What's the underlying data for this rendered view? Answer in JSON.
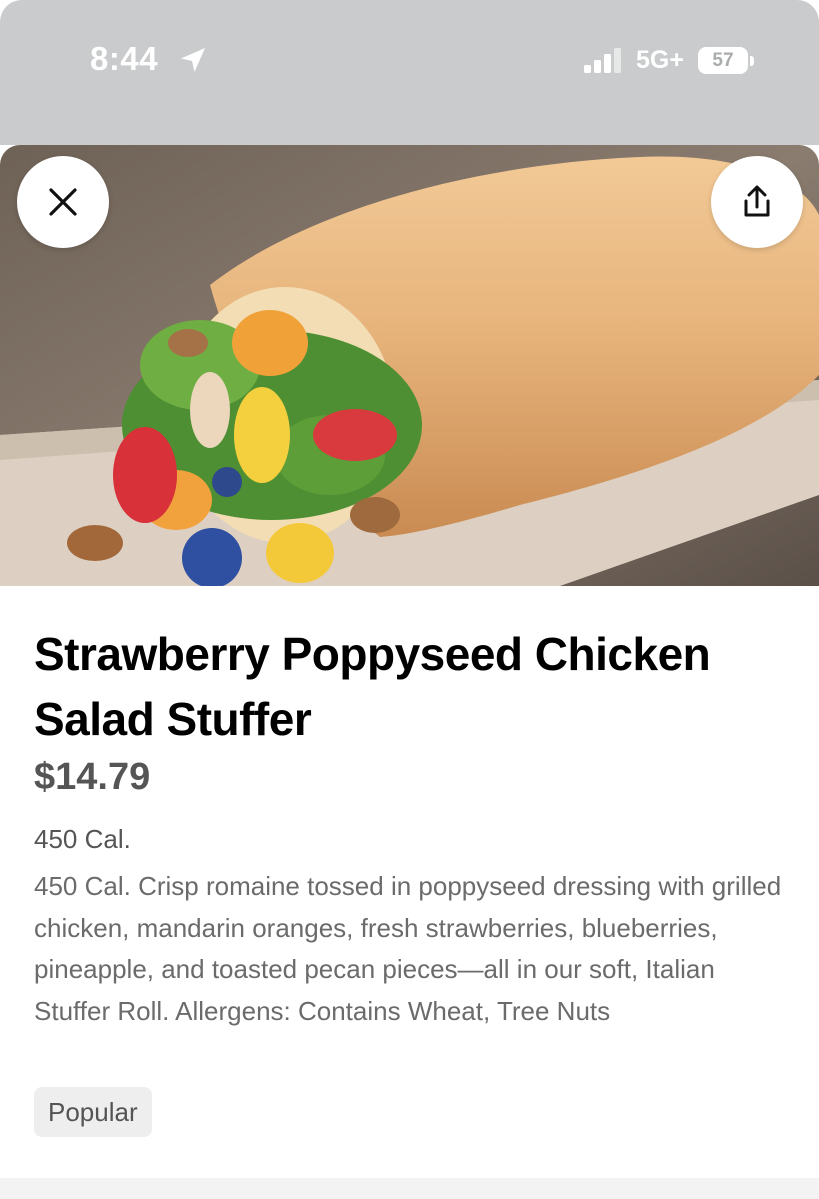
{
  "status_bar": {
    "time": "8:44",
    "network": "5G+",
    "battery": "57",
    "icons": [
      "location-arrow-icon",
      "signal-bars-icon"
    ]
  },
  "hero": {
    "image": "sandwich-photo",
    "actions": {
      "close_icon": "close-icon",
      "share_icon": "share-icon"
    }
  },
  "item": {
    "title": "Strawberry Poppyseed Chicken Salad Stuffer",
    "price": "$14.79",
    "calories": "450 Cal.",
    "description": "450 Cal. Crisp romaine tossed in poppyseed dressing with grilled chicken, mandarin oranges, fresh strawberries, blueberries, pineapple, and toasted pecan pieces—all in our soft, Italian Stuffer Roll. Allergens: Contains Wheat, Tree Nuts",
    "badge": "Popular"
  },
  "colors": {
    "status_bar_bg": "#c9cbcc",
    "title": "#000000",
    "price": "#555555",
    "body_text": "#6b6b6b",
    "badge_bg": "#eeeeee"
  }
}
